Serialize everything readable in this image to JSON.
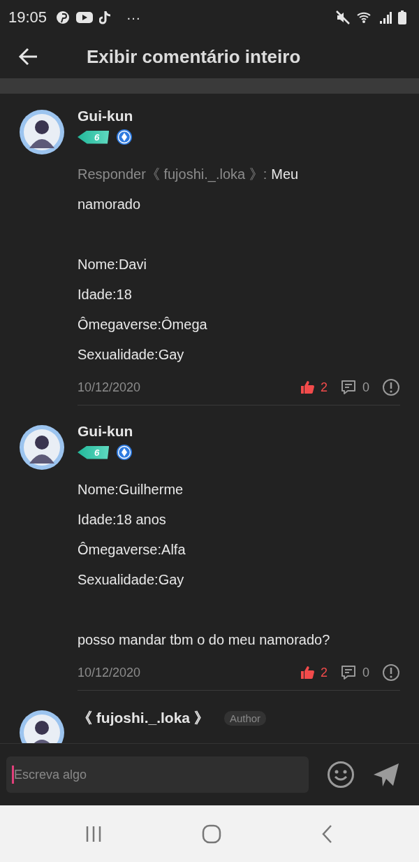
{
  "status_bar": {
    "time": "19:05",
    "more": "···"
  },
  "header": {
    "title": "Exibir comentário inteiro"
  },
  "comments": [
    {
      "author": "Gui-kun",
      "level": "6",
      "reply_prefix": "Responder《 fujoshi._.loka 》:",
      "paragraphs": [
        [
          "Meu namorado"
        ],
        [
          "Nome:Davi",
          "Idade:18",
          "Ômegaverse:Ômega",
          "Sexualidade:Gay"
        ]
      ],
      "date": "10/12/2020",
      "likes": "2",
      "liked": true,
      "replies": "0"
    },
    {
      "author": "Gui-kun",
      "level": "6",
      "paragraphs": [
        [
          "Nome:Guilherme",
          "Idade:18 anos",
          "Ômegaverse:Alfa",
          "Sexualidade:Gay"
        ],
        [
          "posso mandar tbm o do meu namorado?"
        ]
      ],
      "date": "10/12/2020",
      "likes": "2",
      "liked": true,
      "replies": "0"
    },
    {
      "author": "《 fujoshi._.loka 》",
      "tag": "Author"
    }
  ],
  "composer": {
    "placeholder": "Escreva algo"
  }
}
